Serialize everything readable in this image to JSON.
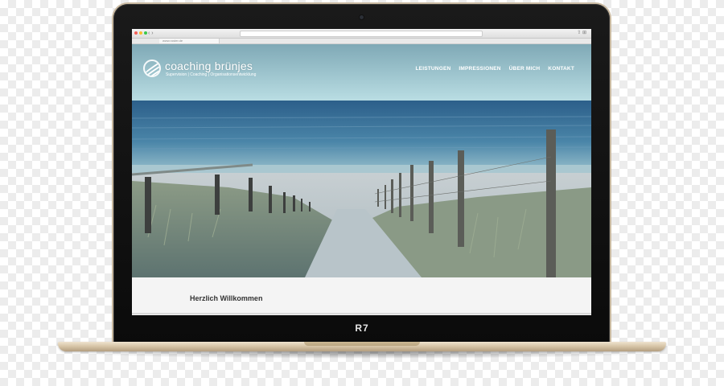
{
  "site": {
    "brand": "coaching brünjes",
    "tagline": "Supervision | Coaching | Organisationsentwicklung",
    "nav": [
      "LEISTUNGEN",
      "IMPRESSIONEN",
      "ÜBER MICH",
      "KONTAKT"
    ],
    "welcome_heading": "Herzlich Willkommen"
  },
  "browser": {
    "tab_label": "www.roster.de"
  },
  "device": {
    "model_label": "R7"
  },
  "colors": {
    "accent_sky": "#9fcdd6",
    "sea": "#3a6f99",
    "sand": "#d9dde0",
    "laptop_gold": "#d8c6a8"
  }
}
